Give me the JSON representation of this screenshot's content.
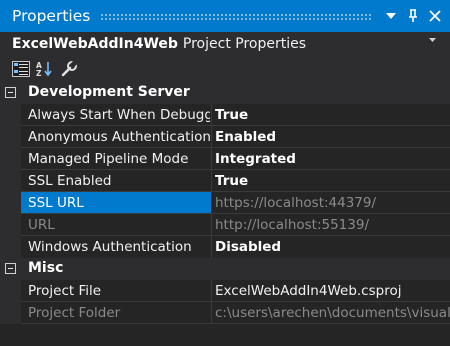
{
  "window": {
    "title": "Properties",
    "dropdown_icon": "chevron-down-icon",
    "pin_icon": "pin-icon",
    "close_icon": "close-icon"
  },
  "selector": {
    "object_name": "ExcelWebAddIn4Web",
    "object_type": "Project Properties"
  },
  "toolbar": {
    "buttons": [
      "categorized-icon",
      "alphabetical-icon",
      "property-pages-icon"
    ]
  },
  "grid": {
    "rows": [
      {
        "kind": "category",
        "label": "Development Server"
      },
      {
        "kind": "property",
        "name": "Always Start When Debugging",
        "value": "True",
        "value_style": "bold"
      },
      {
        "kind": "property",
        "name": "Anonymous Authentication",
        "value": "Enabled",
        "value_style": "bold"
      },
      {
        "kind": "property",
        "name": "Managed Pipeline Mode",
        "value": "Integrated",
        "value_style": "bold"
      },
      {
        "kind": "property",
        "name": "SSL Enabled",
        "value": "True",
        "value_style": "bold"
      },
      {
        "kind": "property",
        "name": "SSL URL",
        "value": "https://localhost:44379/",
        "value_style": "dim",
        "selected": true
      },
      {
        "kind": "property",
        "name": "URL",
        "value": "http://localhost:55139/",
        "value_style": "dim",
        "name_style": "dim"
      },
      {
        "kind": "property",
        "name": "Windows Authentication",
        "value": "Disabled",
        "value_style": "bold"
      },
      {
        "kind": "category",
        "label": "Misc"
      },
      {
        "kind": "property",
        "name": "Project File",
        "value": "ExcelWebAddIn4Web.csproj",
        "value_style": "normal"
      },
      {
        "kind": "property",
        "name": "Project Folder",
        "value": "c:\\users\\arechen\\documents\\visual",
        "value_style": "dim",
        "name_style": "dim"
      }
    ]
  },
  "colors": {
    "accent": "#007acc",
    "background": "#252526",
    "header": "#2d2d30"
  }
}
